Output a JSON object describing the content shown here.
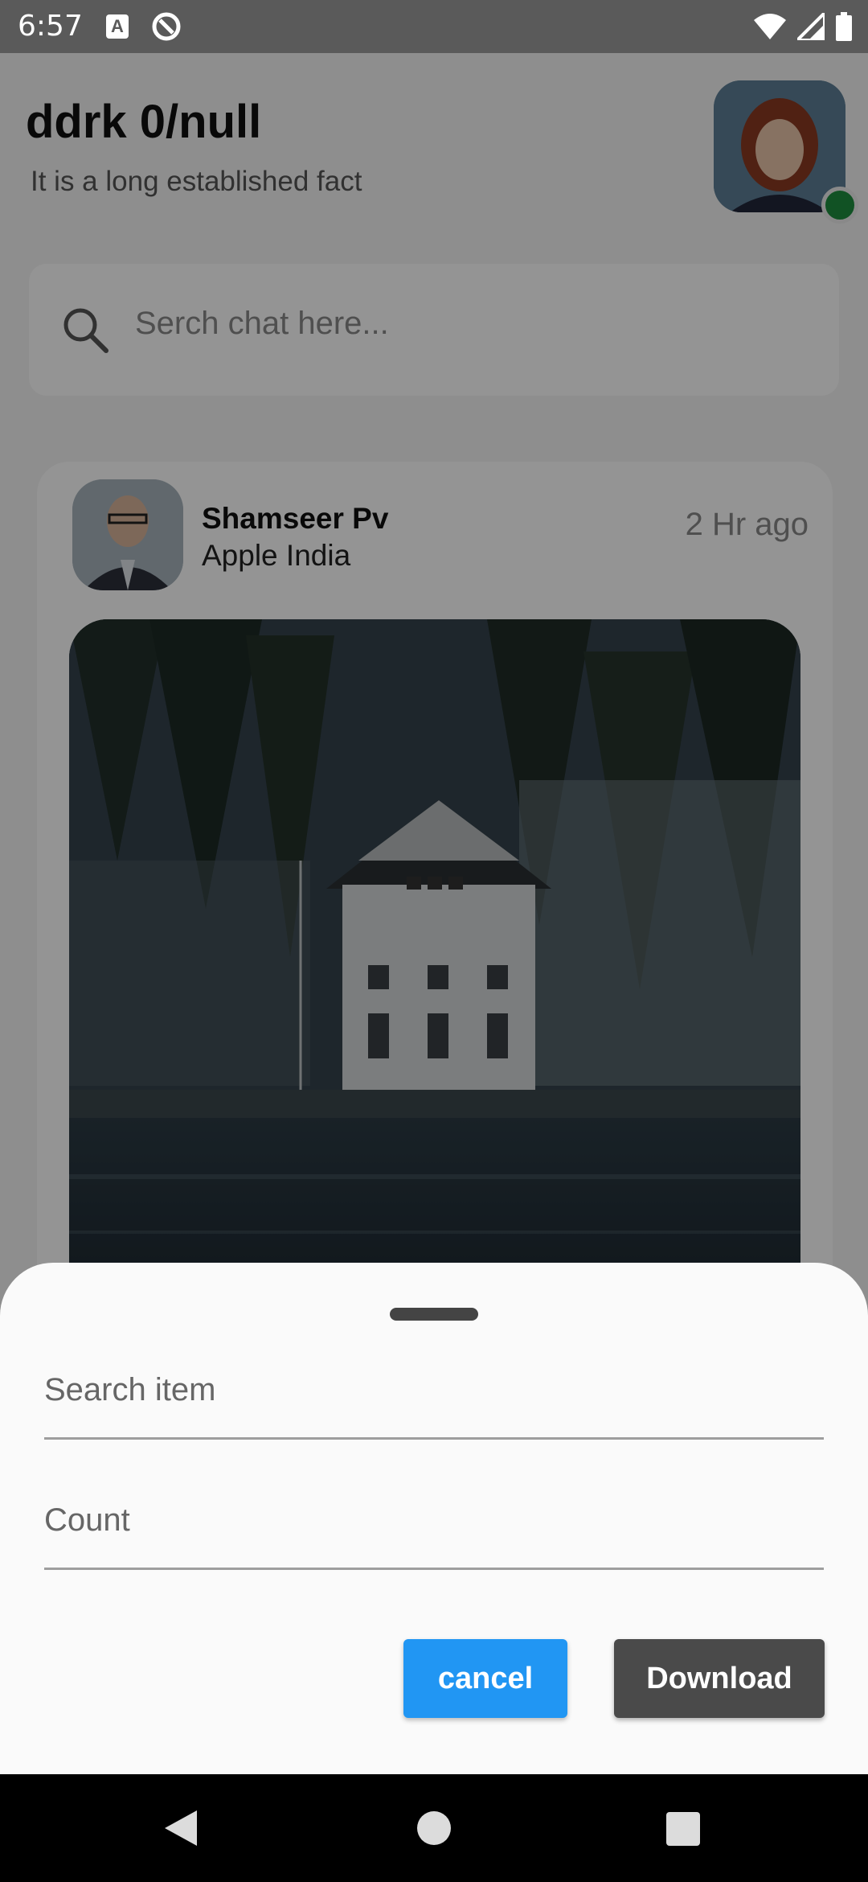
{
  "status_bar": {
    "time": "6:57",
    "icons": [
      "notification-a-icon",
      "sync-icon",
      "wifi-icon",
      "cell-signal-icon",
      "battery-icon"
    ],
    "a_icon_text": "A"
  },
  "header": {
    "title": "ddrk 0/null",
    "subtitle": "It is a long established fact",
    "online_status_color": "#1e8e3e"
  },
  "search": {
    "placeholder": "Serch chat here..."
  },
  "post": {
    "author_name": "Shamseer Pv",
    "company": "Apple India",
    "time_ago": "2 Hr ago"
  },
  "bottom_sheet": {
    "search_item_placeholder": "Search item",
    "count_placeholder": "Count",
    "cancel_label": "cancel",
    "download_label": "Download",
    "cancel_color": "#2196f3",
    "download_color": "#4a4a4a"
  }
}
